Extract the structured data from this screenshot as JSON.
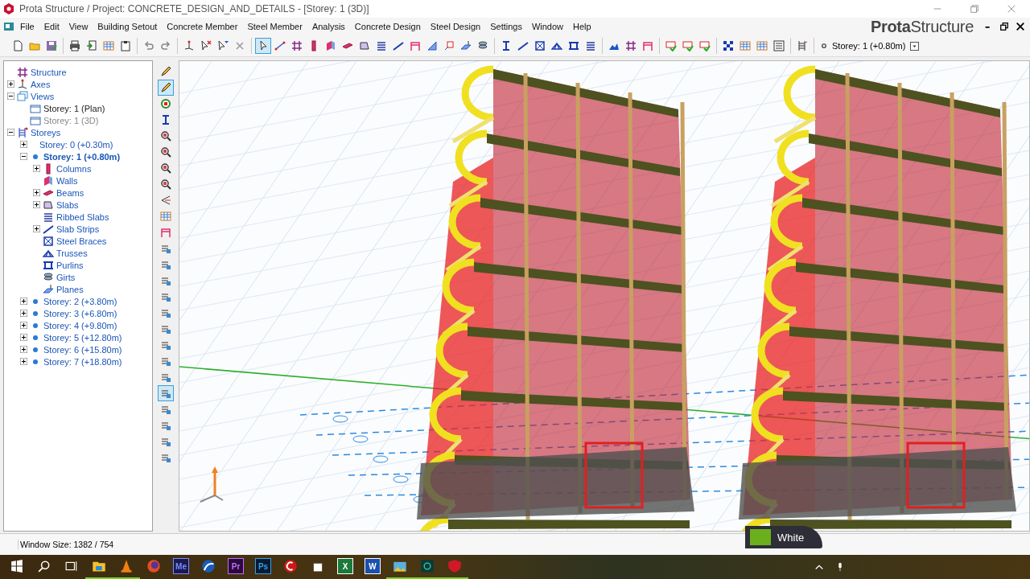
{
  "window": {
    "title": "Prota Structure / Project: CONCRETE_DESIGN_AND_DETAILS - [Storey: 1 (3D)]"
  },
  "menu": {
    "items": [
      "File",
      "Edit",
      "View",
      "Building Setout",
      "Concrete Member",
      "Steel Member",
      "Analysis",
      "Concrete Design",
      "Steel Design",
      "Settings",
      "Window",
      "Help"
    ],
    "brand": "**Prota**Structure"
  },
  "toolbar": {
    "groups": [
      [
        {
          "kind": "doc",
          "selected": false
        },
        {
          "kind": "folder",
          "selected": false
        },
        {
          "kind": "disk",
          "selected": false
        }
      ],
      [
        {
          "kind": "printer",
          "selected": false
        },
        {
          "kind": "export",
          "selected": false
        },
        {
          "kind": "table",
          "selected": false
        },
        {
          "kind": "clipboard",
          "selected": false
        }
      ],
      [
        {
          "kind": "undo",
          "selected": false
        },
        {
          "kind": "redo",
          "selected": false
        }
      ],
      [
        {
          "kind": "axes",
          "selected": false
        },
        {
          "kind": "cursor-x",
          "selected": false
        },
        {
          "kind": "cursor-filter",
          "selected": false
        },
        {
          "kind": "cross",
          "selected": false
        }
      ],
      [
        {
          "kind": "cursor",
          "selected": true
        },
        {
          "kind": "line",
          "selected": false
        },
        {
          "kind": "grid",
          "selected": false
        },
        {
          "kind": "column",
          "selected": false
        },
        {
          "kind": "wall",
          "selected": false
        },
        {
          "kind": "beam",
          "selected": false
        },
        {
          "kind": "slab",
          "selected": false
        },
        {
          "kind": "stack",
          "selected": false
        },
        {
          "kind": "strip",
          "selected": false
        },
        {
          "kind": "frame",
          "selected": false
        },
        {
          "kind": "ramp",
          "selected": false
        },
        {
          "kind": "box",
          "selected": false
        },
        {
          "kind": "plane",
          "selected": false
        },
        {
          "kind": "pipe",
          "selected": false
        }
      ],
      [
        {
          "kind": "ibeam",
          "selected": false
        },
        {
          "kind": "strip",
          "selected": false
        },
        {
          "kind": "brace",
          "selected": false
        },
        {
          "kind": "truss",
          "selected": false
        },
        {
          "kind": "purlin",
          "selected": false
        },
        {
          "kind": "stack",
          "selected": false
        }
      ],
      [
        {
          "kind": "chart",
          "selected": false
        },
        {
          "kind": "grid",
          "selected": false
        },
        {
          "kind": "frame",
          "selected": false
        }
      ],
      [
        {
          "kind": "check",
          "selected": false
        },
        {
          "kind": "check",
          "selected": false
        },
        {
          "kind": "check",
          "selected": false
        }
      ],
      [
        {
          "kind": "pattern",
          "selected": false
        },
        {
          "kind": "table",
          "selected": false
        },
        {
          "kind": "table",
          "selected": false
        },
        {
          "kind": "list",
          "selected": false
        }
      ],
      [
        {
          "kind": "ladder",
          "selected": false
        }
      ]
    ],
    "storey": "Storey: 1 (+0.80m)"
  },
  "tree": [
    {
      "label": "Structure",
      "kind": "grid"
    },
    {
      "label": "Axes",
      "kind": "axes",
      "expanded": false
    },
    {
      "label": "Views",
      "kind": "views",
      "expanded": true,
      "children": [
        {
          "label": "Storey: 1 (Plan)",
          "kind": "view",
          "disabled": false
        },
        {
          "label": "Storey: 1 (3D)",
          "kind": "view",
          "disabled": true
        }
      ]
    },
    {
      "label": "Storeys",
      "kind": "storeys",
      "expanded": true,
      "children": [
        {
          "label": "Storey: 0 (+0.30m)",
          "kind": "none",
          "expanded": false,
          "selected": false
        },
        {
          "label": "Storey: 1 (+0.80m)",
          "kind": "dot",
          "expanded": true,
          "selected": true,
          "children": [
            {
              "label": "Columns",
              "kind": "column",
              "expanded": false
            },
            {
              "label": "Walls",
              "kind": "wall"
            },
            {
              "label": "Beams",
              "kind": "beam",
              "expanded": false
            },
            {
              "label": "Slabs",
              "kind": "slab",
              "expanded": false
            },
            {
              "label": "Ribbed Slabs",
              "kind": "stack"
            },
            {
              "label": "Slab Strips",
              "kind": "strip",
              "expanded": false
            },
            {
              "label": "Steel Braces",
              "kind": "brace"
            },
            {
              "label": "Trusses",
              "kind": "truss"
            },
            {
              "label": "Purlins",
              "kind": "purlin"
            },
            {
              "label": "Girts",
              "kind": "pipe"
            },
            {
              "label": "Planes",
              "kind": "plane"
            }
          ]
        },
        {
          "label": "Storey: 2 (+3.80m)",
          "kind": "dot",
          "expanded": false,
          "selected": false
        },
        {
          "label": "Storey: 3 (+6.80m)",
          "kind": "dot",
          "expanded": false,
          "selected": false
        },
        {
          "label": "Storey: 4 (+9.80m)",
          "kind": "dot",
          "expanded": false,
          "selected": false
        },
        {
          "label": "Storey: 5 (+12.80m)",
          "kind": "dot",
          "expanded": false,
          "selected": false
        },
        {
          "label": "Storey: 6 (+15.80m)",
          "kind": "dot",
          "expanded": false,
          "selected": false
        },
        {
          "label": "Storey: 7 (+18.80m)",
          "kind": "dot",
          "expanded": false,
          "selected": false
        }
      ]
    }
  ],
  "side_toolbar": [
    {
      "kind": "pencil",
      "selected": false
    },
    {
      "kind": "pencil",
      "selected": true
    },
    {
      "kind": "ring",
      "selected": false
    },
    {
      "kind": "ibeam",
      "selected": false
    },
    {
      "kind": "zoom",
      "selected": false
    },
    {
      "kind": "zoom",
      "selected": false
    },
    {
      "kind": "zoom",
      "selected": false
    },
    {
      "kind": "zoom",
      "selected": false
    },
    {
      "kind": "eye",
      "selected": false
    },
    {
      "kind": "table",
      "selected": false
    },
    {
      "kind": "frame",
      "selected": false
    },
    {
      "kind": "layers",
      "selected": false
    },
    {
      "kind": "layers",
      "selected": false
    },
    {
      "kind": "layers",
      "selected": false
    },
    {
      "kind": "layers",
      "selected": false
    },
    {
      "kind": "layers",
      "selected": false
    },
    {
      "kind": "layers",
      "selected": false
    },
    {
      "kind": "layers",
      "selected": false
    },
    {
      "kind": "layers",
      "selected": false
    },
    {
      "kind": "layers",
      "selected": false
    },
    {
      "kind": "layers",
      "selected": true
    },
    {
      "kind": "layers",
      "selected": false
    },
    {
      "kind": "layers",
      "selected": false
    },
    {
      "kind": "layers",
      "selected": false
    },
    {
      "kind": "layers",
      "selected": false
    }
  ],
  "status_bar": {
    "text": "Window Size: 1382 / 754"
  },
  "popup": {
    "text": "White"
  },
  "taskbar": {
    "apps": [
      {
        "kind": "folder",
        "running": true
      },
      {
        "kind": "cone",
        "running": true
      },
      {
        "kind": "globe",
        "running": false
      },
      {
        "kind": "tile",
        "label": "Me",
        "running": false
      },
      {
        "kind": "arc",
        "running": false
      },
      {
        "kind": "tile",
        "label": "Pr",
        "running": false
      },
      {
        "kind": "tile",
        "label": "Ps",
        "running": false
      },
      {
        "kind": "redc",
        "running": false
      },
      {
        "kind": "box",
        "running": false
      },
      {
        "kind": "tile",
        "label": "X",
        "running": false
      },
      {
        "kind": "tile",
        "label": "W",
        "running": false
      },
      {
        "kind": "photo",
        "running": true
      },
      {
        "kind": "app",
        "running": true
      },
      {
        "kind": "shield",
        "running": true
      }
    ]
  }
}
